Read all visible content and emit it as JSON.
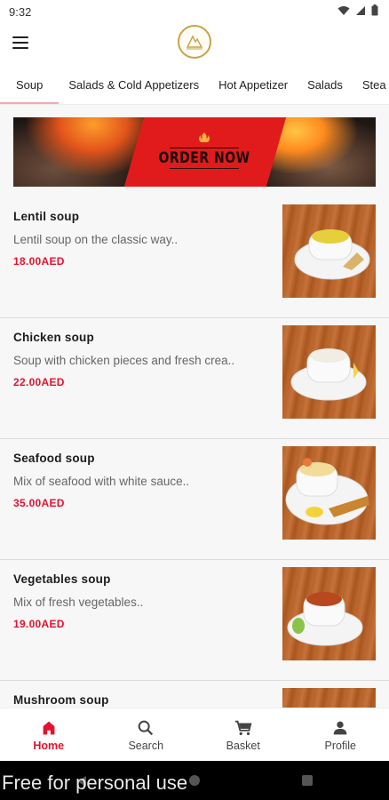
{
  "status_bar": {
    "time": "9:32"
  },
  "tabs": [
    {
      "label": "Soup",
      "active": true
    },
    {
      "label": "Salads & Cold Appetizers"
    },
    {
      "label": "Hot Appetizer"
    },
    {
      "label": "Salads"
    },
    {
      "label": "Stea"
    }
  ],
  "banner": {
    "text": "ORDER NOW"
  },
  "items": [
    {
      "name": "Lentil soup",
      "description": "Lentil soup on the classic way..",
      "price": "18.00AED",
      "soup_color": "#e6cf3a"
    },
    {
      "name": "Chicken soup",
      "description": "Soup with chicken pieces and fresh crea..",
      "price": "22.00AED",
      "soup_color": "#f1ede4"
    },
    {
      "name": "Seafood soup",
      "description": "Mix of seafood with white sauce..",
      "price": "35.00AED",
      "soup_color": "#f2dc9a"
    },
    {
      "name": "Vegetables soup",
      "description": "Mix of fresh vegetables..",
      "price": "19.00AED",
      "soup_color": "#b8481e"
    },
    {
      "name": "Mushroom soup",
      "description": "",
      "price": "",
      "soup_color": "#d9c9a6"
    }
  ],
  "bottom_nav": [
    {
      "label": "Home",
      "icon": "home-icon",
      "active": true
    },
    {
      "label": "Search",
      "icon": "search-icon"
    },
    {
      "label": "Basket",
      "icon": "cart-icon"
    },
    {
      "label": "Profile",
      "icon": "profile-icon"
    }
  ],
  "watermark": "Free for personal use",
  "colors": {
    "accent": "#e5112f",
    "tab_indicator": "#f3a9a9",
    "banner_red": "#e11b1b",
    "logo_gold": "#c9a24a"
  }
}
